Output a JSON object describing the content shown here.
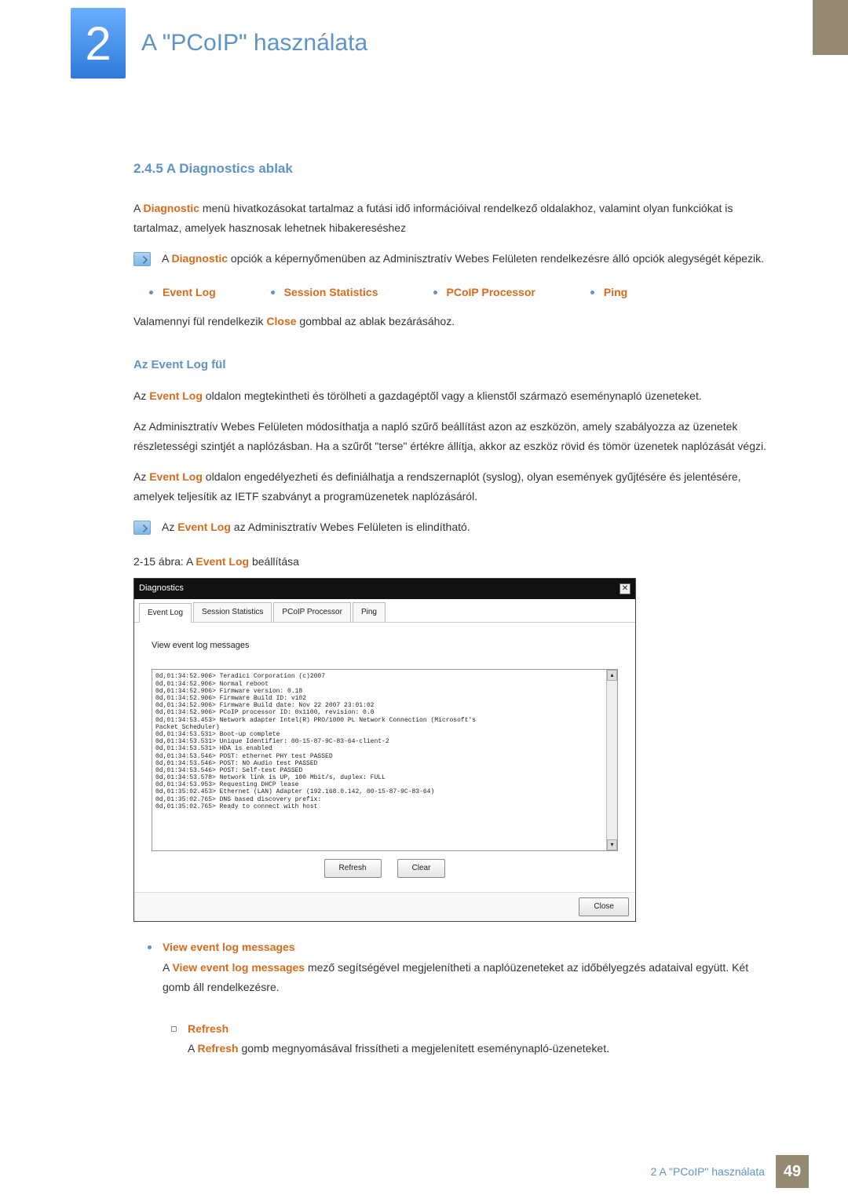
{
  "chapter": {
    "number": "2",
    "title": "A \"PCoIP\" használata"
  },
  "section": {
    "heading": "2.4.5   A Diagnostics ablak",
    "intro_pre": "A ",
    "intro_hl": "Diagnostic",
    "intro_post": " menü hivatkozásokat tartalmaz a futási idő információival rendelkező oldalakhoz, valamint olyan funkciókat is tartalmaz, amelyek hasznosak lehetnek hibakereséshez",
    "note1_pre": "A ",
    "note1_hl": "Diagnostic",
    "note1_post": " opciók a képernyőmenüben az Adminisztratív Webes Felületen rendelkezésre álló opciók alegységét képezik.",
    "bullets": [
      "Event Log",
      "Session Statistics",
      "PCoIP Processor",
      "Ping"
    ],
    "close_line_pre": "Valamennyi fül rendelkezik ",
    "close_line_hl": "Close",
    "close_line_post": " gombbal az ablak bezárásához."
  },
  "eventlog": {
    "heading": "Az Event Log fül",
    "p1_pre": "Az ",
    "p1_hl": "Event Log",
    "p1_post": " oldalon megtekintheti és törölheti a gazdagéptől vagy a klienstől származó eseménynapló üzeneteket.",
    "p2": "Az Adminisztratív Webes Felületen módosíthatja a napló szűrő beállítást azon az eszközön, amely szabályozza az üzenetek részletességi szintjét a naplózásban. Ha a szűrőt \"terse\" értékre állítja, akkor az eszköz rövid és tömör üzenetek naplózását végzi.",
    "p3_pre": "Az ",
    "p3_hl": "Event Log",
    "p3_post": " oldalon engedélyezheti és definiálhatja a rendszernaplót (syslog), olyan események gyűjtésére és jelentésére, amelyek teljesítik az IETF szabványt a programüzenetek naplózásáról.",
    "note2_pre": "Az ",
    "note2_hl": "Event Log",
    "note2_post": " az Adminisztratív Webes Felületen is elindítható.",
    "fig_caption_pre": "2-15 ábra: A ",
    "fig_caption_hl": "Event Log",
    "fig_caption_post": " beállítása"
  },
  "diag": {
    "title": "Diagnostics",
    "tabs": [
      "Event Log",
      "Session Statistics",
      "PCoIP Processor",
      "Ping"
    ],
    "panel_heading": "View event log messages",
    "log": "0d,01:34:52.906> Teradici Corporation (c)2007\n0d,01:34:52.906> Normal reboot\n0d,01:34:52.906> Firmware version: 0.18\n0d,01:34:52.906> Firmware Build ID: v102\n0d,01:34:52.906> Firmware Build date: Nov 22 2007 23:01:02\n0d,01:34:52.906> PCoIP processor ID: 0x1100, revision: 0.0\n0d,01:34:53.453> Network adapter Intel(R) PRO/1000 PL Network Connection (Microsoft's\nPacket Scheduler)\n0d,01:34:53.531> Boot-up complete\n0d,01:34:53.531> Unique Identifier: 00-15-87-9C-83-64-client-2\n0d,01:34:53.531> HDA is enabled\n0d,01:34:53.546> POST: ethernet PHY test PASSED\n0d,01:34:53.546> POST: NO Audio test PASSED\n0d,01:34:53.546> POST: Self-test PASSED\n0d,01:34:53.578> Network link is UP, 100 Mbit/s, duplex: FULL\n0d,01:34:53.953> Requesting DHCP lease\n0d,01:35:02.453> Ethernet (LAN) Adapter (192.168.0.142, 00-15-87-9C-83-64)\n0d,01:35:02.765> DNS based discovery prefix:\n0d,01:35:02.765> Ready to connect with host",
    "refresh": "Refresh",
    "clear": "Clear",
    "close": "Close"
  },
  "below": {
    "view_label": "View event log messages",
    "view_desc_pre": "A ",
    "view_desc_hl": "View event log messages",
    "view_desc_post": " mező segítségével megjelenítheti a naplóüzeneteket az időbélyegzés adataival együtt. Két gomb áll rendelkezésre.",
    "refresh_label": "Refresh",
    "refresh_desc_pre": "A ",
    "refresh_desc_hl": "Refresh",
    "refresh_desc_post": " gomb megnyomásával frissítheti a megjelenített eseménynapló-üzeneteket."
  },
  "footer": {
    "text": "2 A \"PCoIP\" használata",
    "page": "49"
  }
}
